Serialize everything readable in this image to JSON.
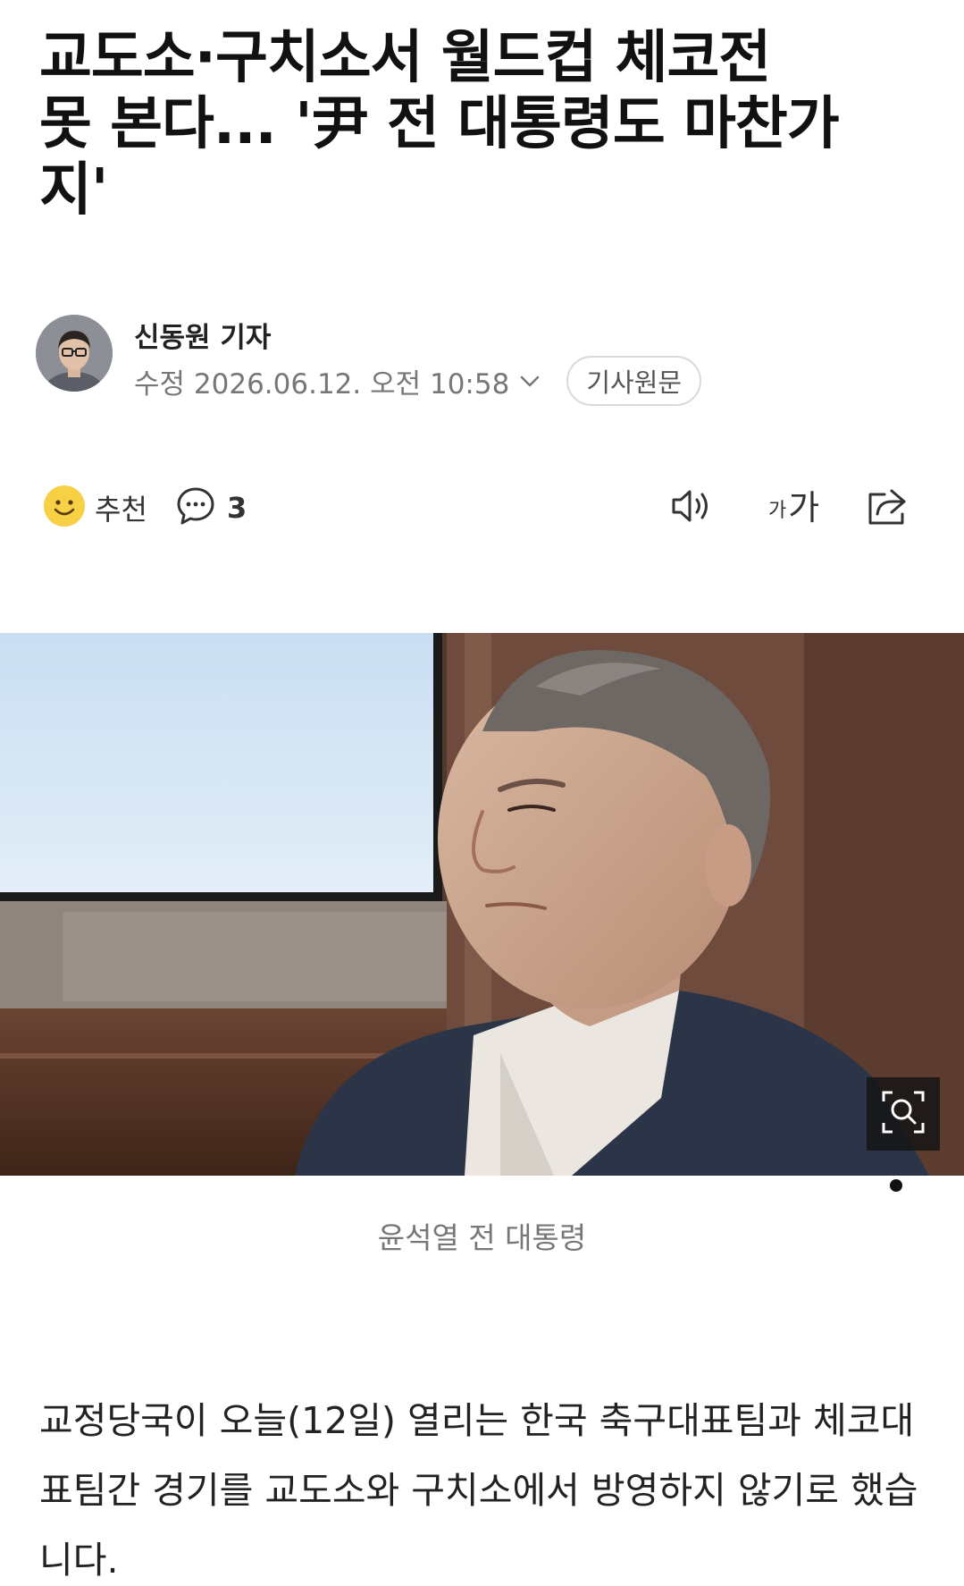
{
  "article": {
    "headline_line1": "교도소·구치소서 월드컵 체코전",
    "headline_line2": "못 본다... '尹 전 대통령도 마찬가",
    "headline_line3": "지'",
    "author": "신동원 기자",
    "modified": "수정 2026.06.12. 오전 10:58",
    "source_button": "기사원문",
    "caption": "윤석열 전 대통령",
    "body": "교정당국이 오늘(12일) 열리는 한국 축구대표팀과 체코대표팀간 경기를 교도소와 구치소에서 방영하지 않기로 했습니다."
  },
  "actions": {
    "recommend_label": "추천",
    "comment_count": "3",
    "font_small": "가",
    "font_large": "가"
  },
  "icons": {
    "recommend": "smile-icon",
    "comment": "comment-bubble-icon",
    "tts": "speaker-icon",
    "font": "font-size-icon",
    "share": "share-icon",
    "zoom": "zoom-search-icon",
    "dropdown": "chevron-down-icon"
  },
  "colors": {
    "smile_yellow": "#f7d046",
    "text_primary": "#111111",
    "text_meta": "#777777"
  }
}
